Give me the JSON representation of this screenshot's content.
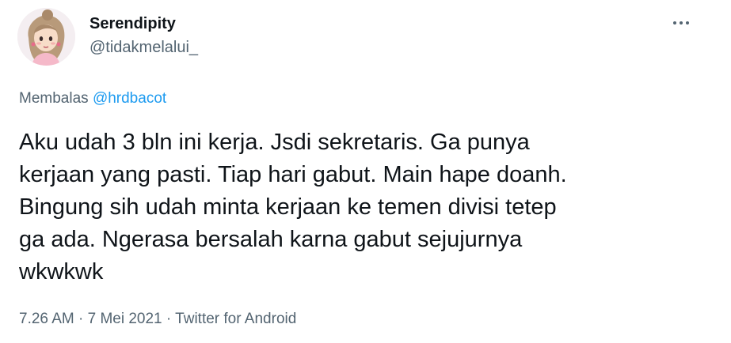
{
  "user": {
    "display_name": "Serendipity",
    "handle": "@tidakmelalui_"
  },
  "reply": {
    "prefix": "Membalas",
    "mention": "@hrdbacot"
  },
  "tweet": {
    "text": "Aku udah 3 bln ini kerja. Jsdi sekretaris. Ga punya\nkerjaan yang pasti. Tiap hari gabut. Main hape doanh.\nBingung sih udah minta kerjaan ke temen divisi tetep\nga ada. Ngerasa bersalah karna gabut sejujurnya\nwkwkwk"
  },
  "meta": {
    "time": "7.26 AM",
    "separator1": " · ",
    "date": "7 Mei 2021",
    "separator2": " · ",
    "source": "Twitter for Android"
  },
  "icons": {
    "more": "more-dots-icon",
    "avatar": "cartoon-girl-avatar"
  },
  "colors": {
    "text": "#0f1419",
    "secondary": "#536471",
    "link": "#1d9bf0"
  }
}
